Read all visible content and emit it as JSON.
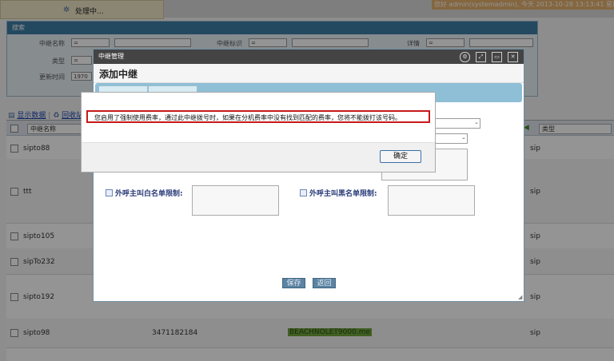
{
  "status": {
    "processing": "处理中..."
  },
  "header": {
    "welcome": "您好 admin(systemadmin), 今天 2013-10-28 13:13:41 星期"
  },
  "search": {
    "title": "搜索",
    "fields": {
      "trunk_name": "中继名称",
      "trunk_id": "中继标识",
      "detail": "详情",
      "type": "类型",
      "update_time": "更新时间"
    },
    "select_value": "=",
    "time_value": "1970"
  },
  "list": {
    "show_data": "显示数据",
    "recycle": "回收站",
    "columns": {
      "name": "中继名称",
      "type": "类型"
    },
    "rows": [
      {
        "name": "sipto88",
        "number": "",
        "value": "",
        "type": "sip"
      },
      {
        "name": "ttt",
        "number": "",
        "value": "",
        "type": "sip"
      },
      {
        "name": "sipto105",
        "number": "",
        "value": "",
        "type": "sip"
      },
      {
        "name": "sipTo232",
        "number": "",
        "value": "",
        "type": "sip"
      },
      {
        "name": "sipto192",
        "number": "",
        "value": "",
        "type": "sip"
      },
      {
        "name": "sipto98",
        "number": "3471182184",
        "value": "BEACHNOLET9000.me",
        "type": "sip"
      }
    ]
  },
  "dialog": {
    "window_title": "中继管理",
    "title": "添加中继",
    "whitelist_label": "外呼主叫白名单限制:",
    "blacklist_label": "外呼主叫黑名单限制:",
    "save": "保存",
    "back": "返回"
  },
  "alert": {
    "message": "您启用了强制使用费率，通过此中继拨号时，如果在分机费率中没有找到匹配的费率，您将不能拨打该号码。",
    "ok": "确定"
  }
}
